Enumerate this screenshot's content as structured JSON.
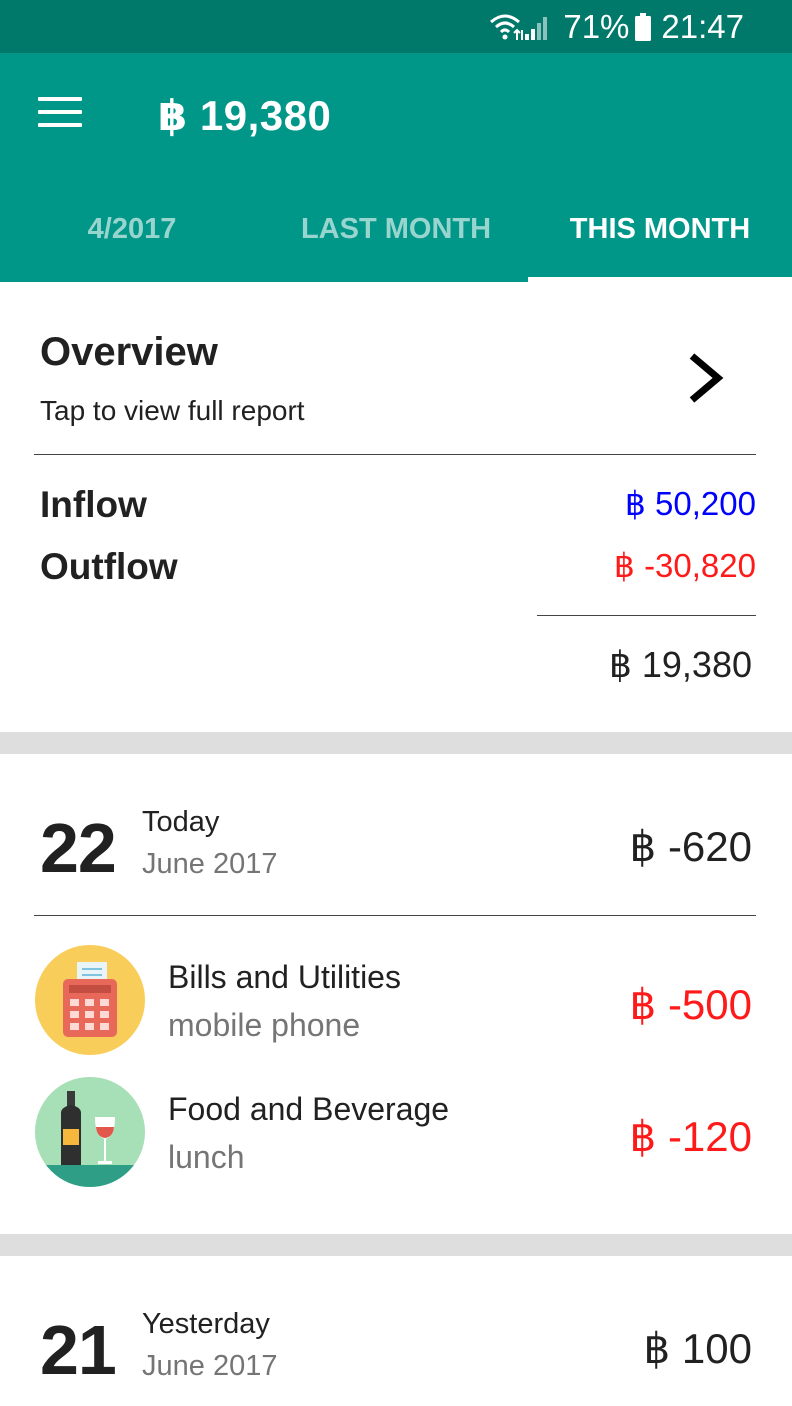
{
  "status_bar": {
    "battery_percent": "71%",
    "time": "21:47",
    "icons": [
      "wifi-icon",
      "signal-icon",
      "battery-icon"
    ]
  },
  "app_bar": {
    "menu_icon": "menu-icon",
    "balance": "฿ 19,380"
  },
  "tabs": [
    {
      "label": "4/2017",
      "active": false
    },
    {
      "label": "LAST MONTH",
      "active": false
    },
    {
      "label": "THIS MONTH",
      "active": true
    }
  ],
  "overview": {
    "title": "Overview",
    "subtitle": "Tap to view full report",
    "chevron_icon": "chevron-right-icon",
    "inflow_label": "Inflow",
    "inflow_value": "฿ 50,200",
    "outflow_label": "Outflow",
    "outflow_value": "฿ -30,820",
    "net_value": "฿ 19,380"
  },
  "days": [
    {
      "day": "22",
      "label": "Today",
      "month": "June 2017",
      "total": "฿ -620",
      "transactions": [
        {
          "icon": "bills-utilities-icon",
          "category": "Bills and Utilities",
          "note": "mobile phone",
          "amount": "฿ -500"
        },
        {
          "icon": "food-beverage-icon",
          "category": "Food and Beverage",
          "note": "lunch",
          "amount": "฿ -120"
        }
      ]
    },
    {
      "day": "21",
      "label": "Yesterday",
      "month": "June 2017",
      "total": "฿ 100",
      "transactions": []
    }
  ],
  "colors": {
    "status_bar": "#00796b",
    "app_bar": "#009688",
    "inflow": "#0000ff",
    "outflow": "#ff1a1a"
  }
}
